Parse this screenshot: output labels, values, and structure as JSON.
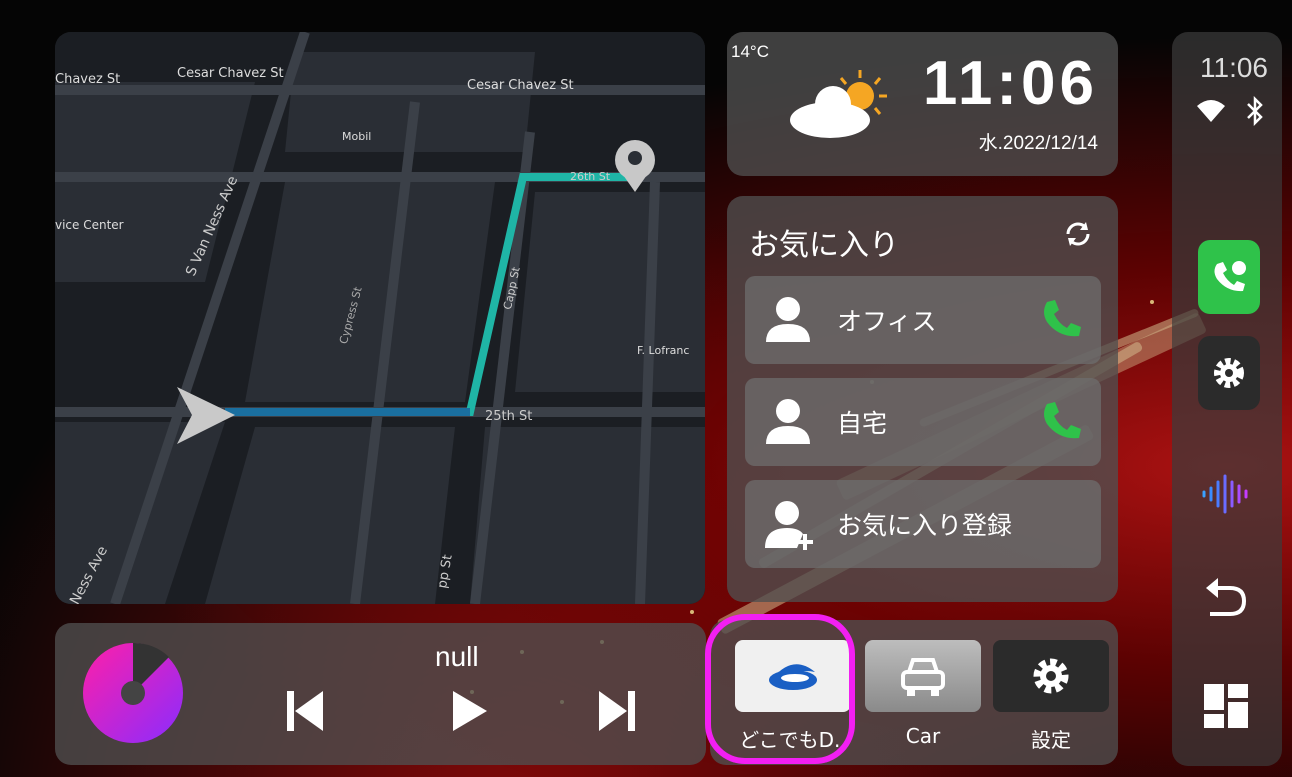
{
  "map": {
    "labels": {
      "chavez_left": "Chavez St",
      "cesar_chavez_1": "Cesar Chavez St",
      "cesar_chavez_2": "Cesar Chavez St",
      "mobil": "Mobil",
      "service_center": "vice Center",
      "s_van_ness": "S Van Ness Ave",
      "cypress": "Cypress St",
      "capp": "Capp St",
      "capp_bottom": "pp St",
      "st_26th": "26th St",
      "st_25th": "25th St",
      "f_lofrano": "F. Lofranc",
      "ness_ave": "Ness Ave"
    }
  },
  "weather": {
    "temperature": "14°C",
    "time": "11:06",
    "date": "水.2022/12/14",
    "icon": "partly-cloudy-icon"
  },
  "favorites": {
    "title": "お気に入り",
    "items": [
      {
        "label": "オフィス",
        "icon": "person-icon",
        "action_icon": "phone-icon"
      },
      {
        "label": "自宅",
        "icon": "person-icon",
        "action_icon": "phone-icon"
      },
      {
        "label": "お気に入り登録",
        "icon": "add-person-icon"
      }
    ]
  },
  "status": {
    "time": "11:06",
    "icons": [
      "wifi-icon",
      "bluetooth-icon"
    ],
    "buttons": [
      "phone-app-icon",
      "settings-icon",
      "voice-icon",
      "back-icon",
      "dashboard-icon"
    ]
  },
  "media": {
    "title": "null",
    "controls": [
      "previous-icon",
      "play-icon",
      "next-icon"
    ]
  },
  "apps": [
    {
      "label": "どこでもD..",
      "icon": "dokodemo-app-icon"
    },
    {
      "label": "Car",
      "icon": "car-icon"
    },
    {
      "label": "設定",
      "icon": "settings-icon"
    }
  ],
  "colors": {
    "highlight": "#f21ff2",
    "route": "#1fb5a6",
    "phone_green": "#2fc24a"
  }
}
